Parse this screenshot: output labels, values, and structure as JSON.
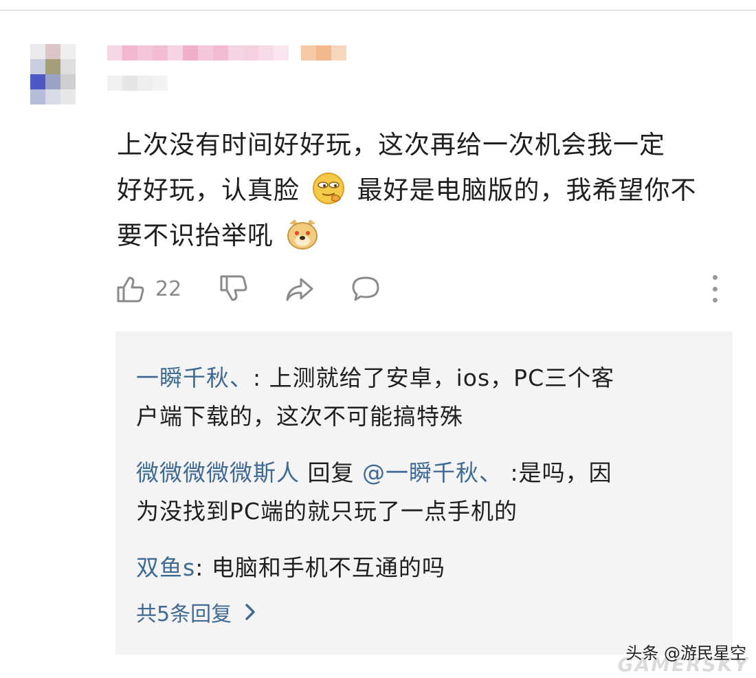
{
  "comment": {
    "text_line1": "上次没有时间好好玩，这次再给一次机会我一定",
    "text_line2_a": "好好玩，认真脸",
    "text_line2_b": "最好是电脑版的，我希望你不",
    "text_line3": "要不识抬举吼",
    "emojis": [
      "smirk-emoji",
      "doge-emoji"
    ]
  },
  "actions": {
    "like_count": "22",
    "icons": [
      "thumbs-up-icon",
      "thumbs-down-icon",
      "share-icon",
      "comment-icon",
      "more-icon"
    ]
  },
  "replies": [
    {
      "user": "一瞬千秋、",
      "sep": ":",
      "text_line1": " 上测就给了安卓，ios，PC三个客",
      "text_line2": "户端下载的，这次不可能搞特殊"
    },
    {
      "user": "微微微微微斯人",
      "reply_word": " 回复 ",
      "mention": "@一瞬千秋、",
      "text_line1": " :是吗，因",
      "text_line2": "为没找到PC端的就只玩了一点手机的"
    },
    {
      "user": "双鱼s",
      "sep": ":",
      "text_line1": " 电脑和手机不互通的吗"
    }
  ],
  "more_replies": "共5条回复",
  "watermark": {
    "source": "头条 @游民星空",
    "brand": "GAMERSKY"
  },
  "colors": {
    "username_blue": "#3f6a93",
    "reply_bg": "#f4f4f5",
    "icon_gray": "#8a8a8a"
  }
}
